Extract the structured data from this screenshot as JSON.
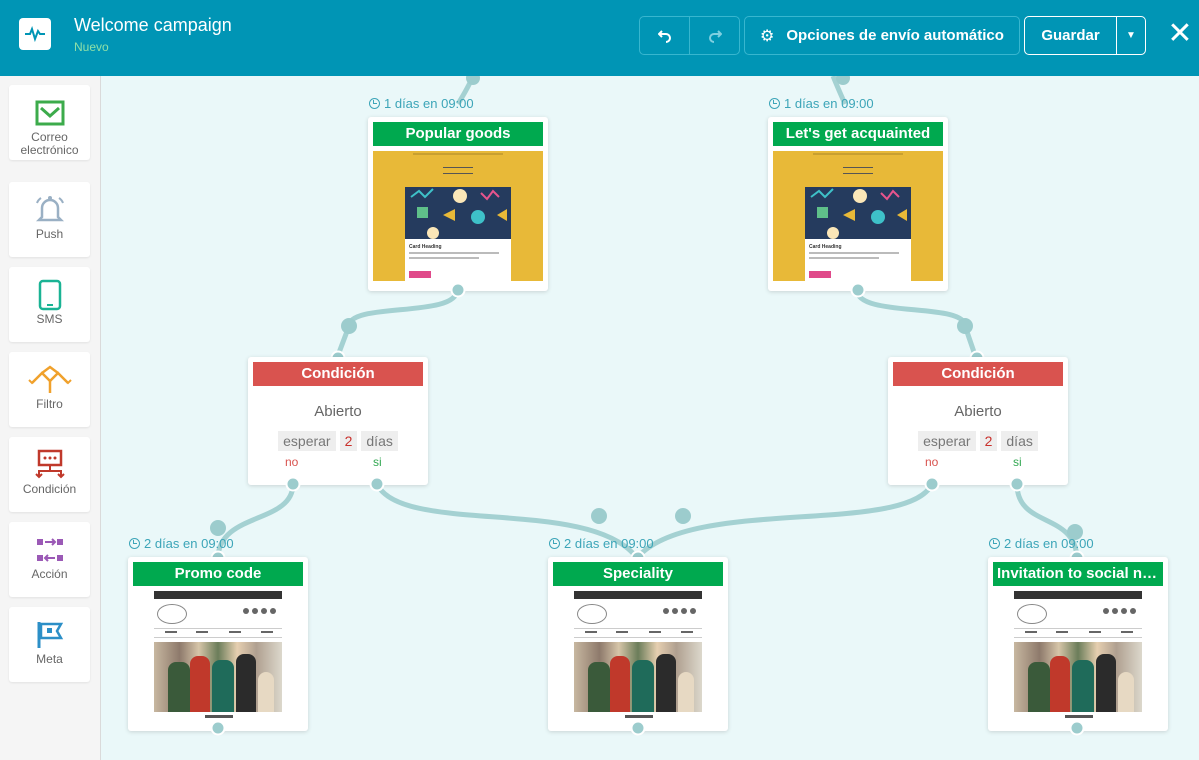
{
  "header": {
    "title": "Welcome campaign",
    "subtitle": "Nuevo",
    "options_label": "Opciones de envío automático",
    "save_label": "Guardar"
  },
  "sidebar": {
    "items": [
      {
        "label": "Correo electrónico",
        "icon": "envelope-icon",
        "color": "#3cab4b"
      },
      {
        "label": "Push",
        "icon": "bell-icon",
        "color": "#9ab0c4"
      },
      {
        "label": "SMS",
        "icon": "phone-icon",
        "color": "#1ab394"
      },
      {
        "label": "Filtro",
        "icon": "filter-icon",
        "color": "#f0a12c"
      },
      {
        "label": "Condición",
        "icon": "condition-icon",
        "color": "#c0392b"
      },
      {
        "label": "Acción",
        "icon": "action-icon",
        "color": "#9b59b6"
      },
      {
        "label": "Meta",
        "icon": "flag-icon",
        "color": "#2c8fc7"
      }
    ]
  },
  "emails": [
    {
      "name": "Popular goods",
      "delay": "1 días en 09:00",
      "template": "yellow"
    },
    {
      "name": "Let's get acquainted",
      "delay": "1 días en 09:00",
      "template": "yellow"
    },
    {
      "name": "Promo code",
      "delay": "2 días en 09:00",
      "template": "fashion"
    },
    {
      "name": "Speciality",
      "delay": "2 días en 09:00",
      "template": "fashion"
    },
    {
      "name": "Invitation to social ne...",
      "delay": "2 días en 09:00",
      "template": "fashion"
    }
  ],
  "conditions": [
    {
      "title": "Condición",
      "event": "Abierto",
      "wait_label": "esperar",
      "wait_value": "2",
      "wait_unit": "días",
      "no_label": "no",
      "yes_label": "si"
    },
    {
      "title": "Condición",
      "event": "Abierto",
      "wait_label": "esperar",
      "wait_value": "2",
      "wait_unit": "días",
      "no_label": "no",
      "yes_label": "si"
    }
  ],
  "template_text": {
    "card_heading": "Card Heading",
    "fashion_caption": "Lorem ipsum"
  },
  "colors": {
    "header_bg": "#0095b5",
    "email_header": "#00a94f",
    "condition_header": "#d9534f",
    "link_line": "#a4d1d2"
  }
}
